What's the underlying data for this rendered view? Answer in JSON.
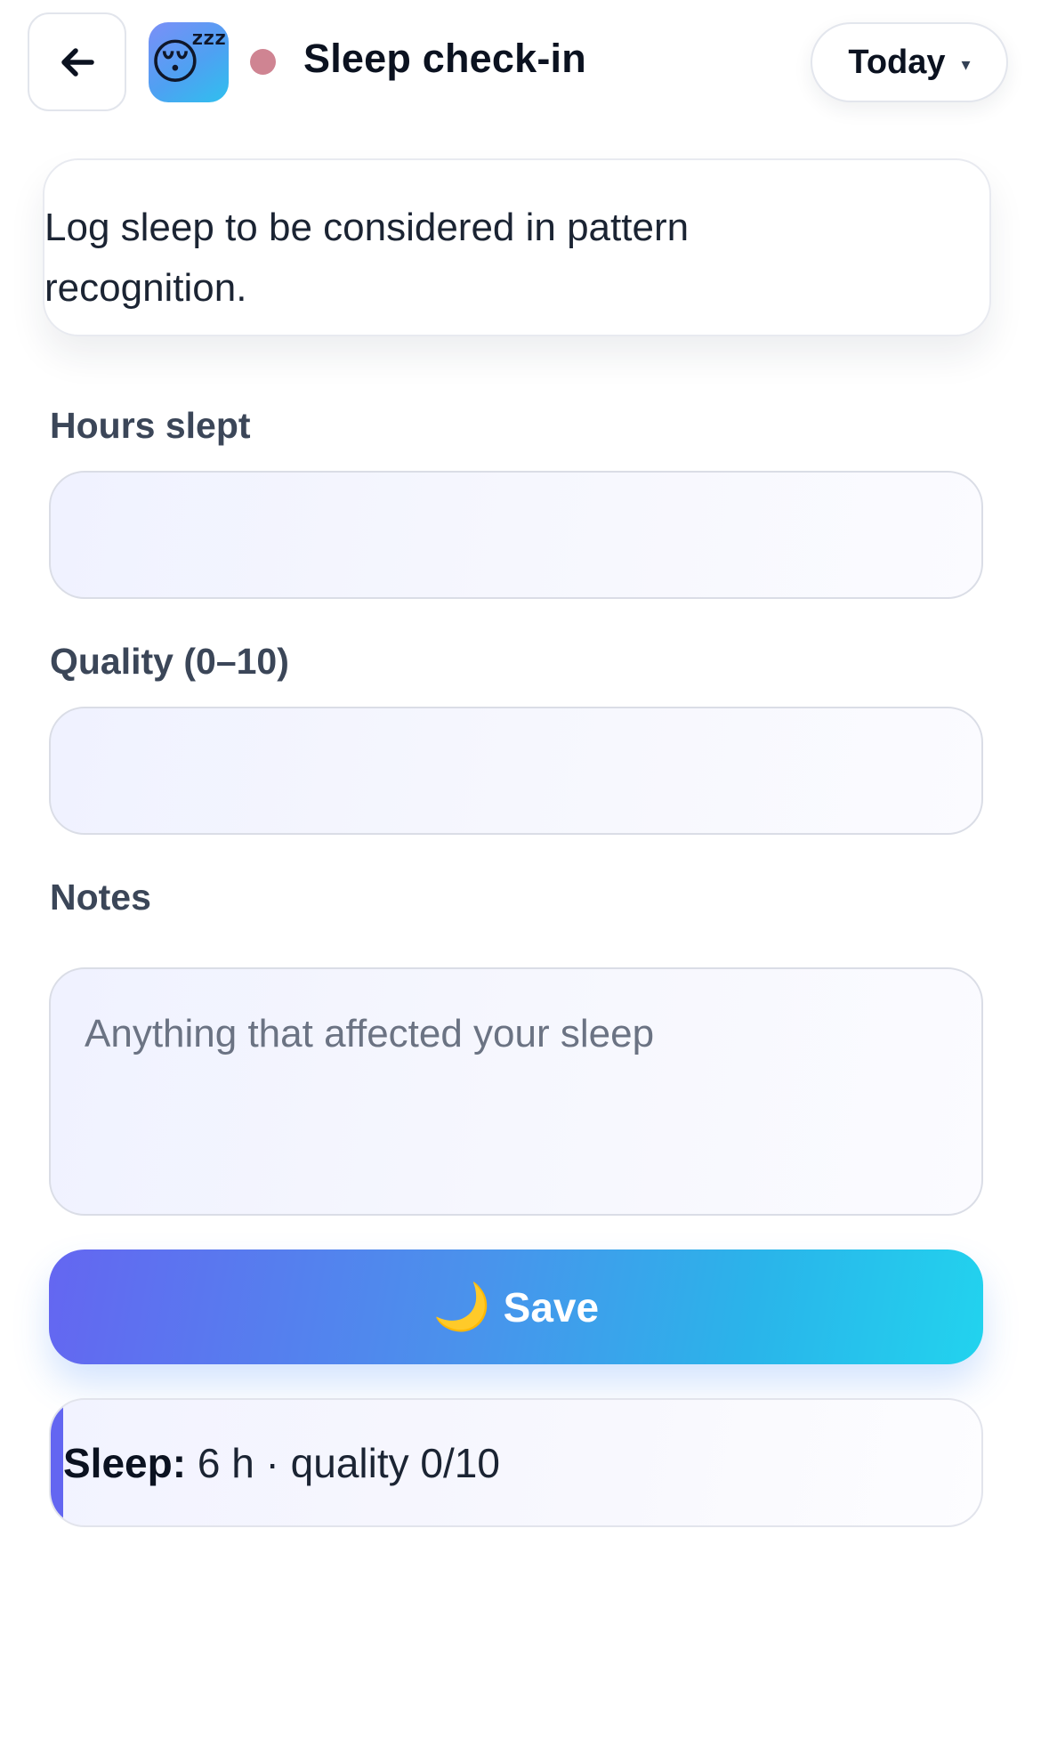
{
  "header": {
    "back_icon": "arrow-left-icon",
    "app_icon": "😴",
    "status_color": "#cf8492",
    "title": "Sleep check-in",
    "date_selected": "Today",
    "date_caret": "▾"
  },
  "info": {
    "text": "Log sleep to be considered in pattern recognition."
  },
  "form": {
    "hours_label": "Hours slept",
    "hours_value": "",
    "quality_label": "Quality (0–10)",
    "quality_value": "",
    "notes_label": "Notes",
    "notes_placeholder": "Anything that affected your sleep",
    "notes_value": ""
  },
  "save_button": {
    "icon": "🌙",
    "label": "Save"
  },
  "summary": {
    "label": "Sleep:",
    "value": "6 h · quality 0/10"
  },
  "colors": {
    "accent": "#6366f1",
    "button_gradient_start": "#6466f1",
    "button_gradient_end": "#22d3ee"
  }
}
